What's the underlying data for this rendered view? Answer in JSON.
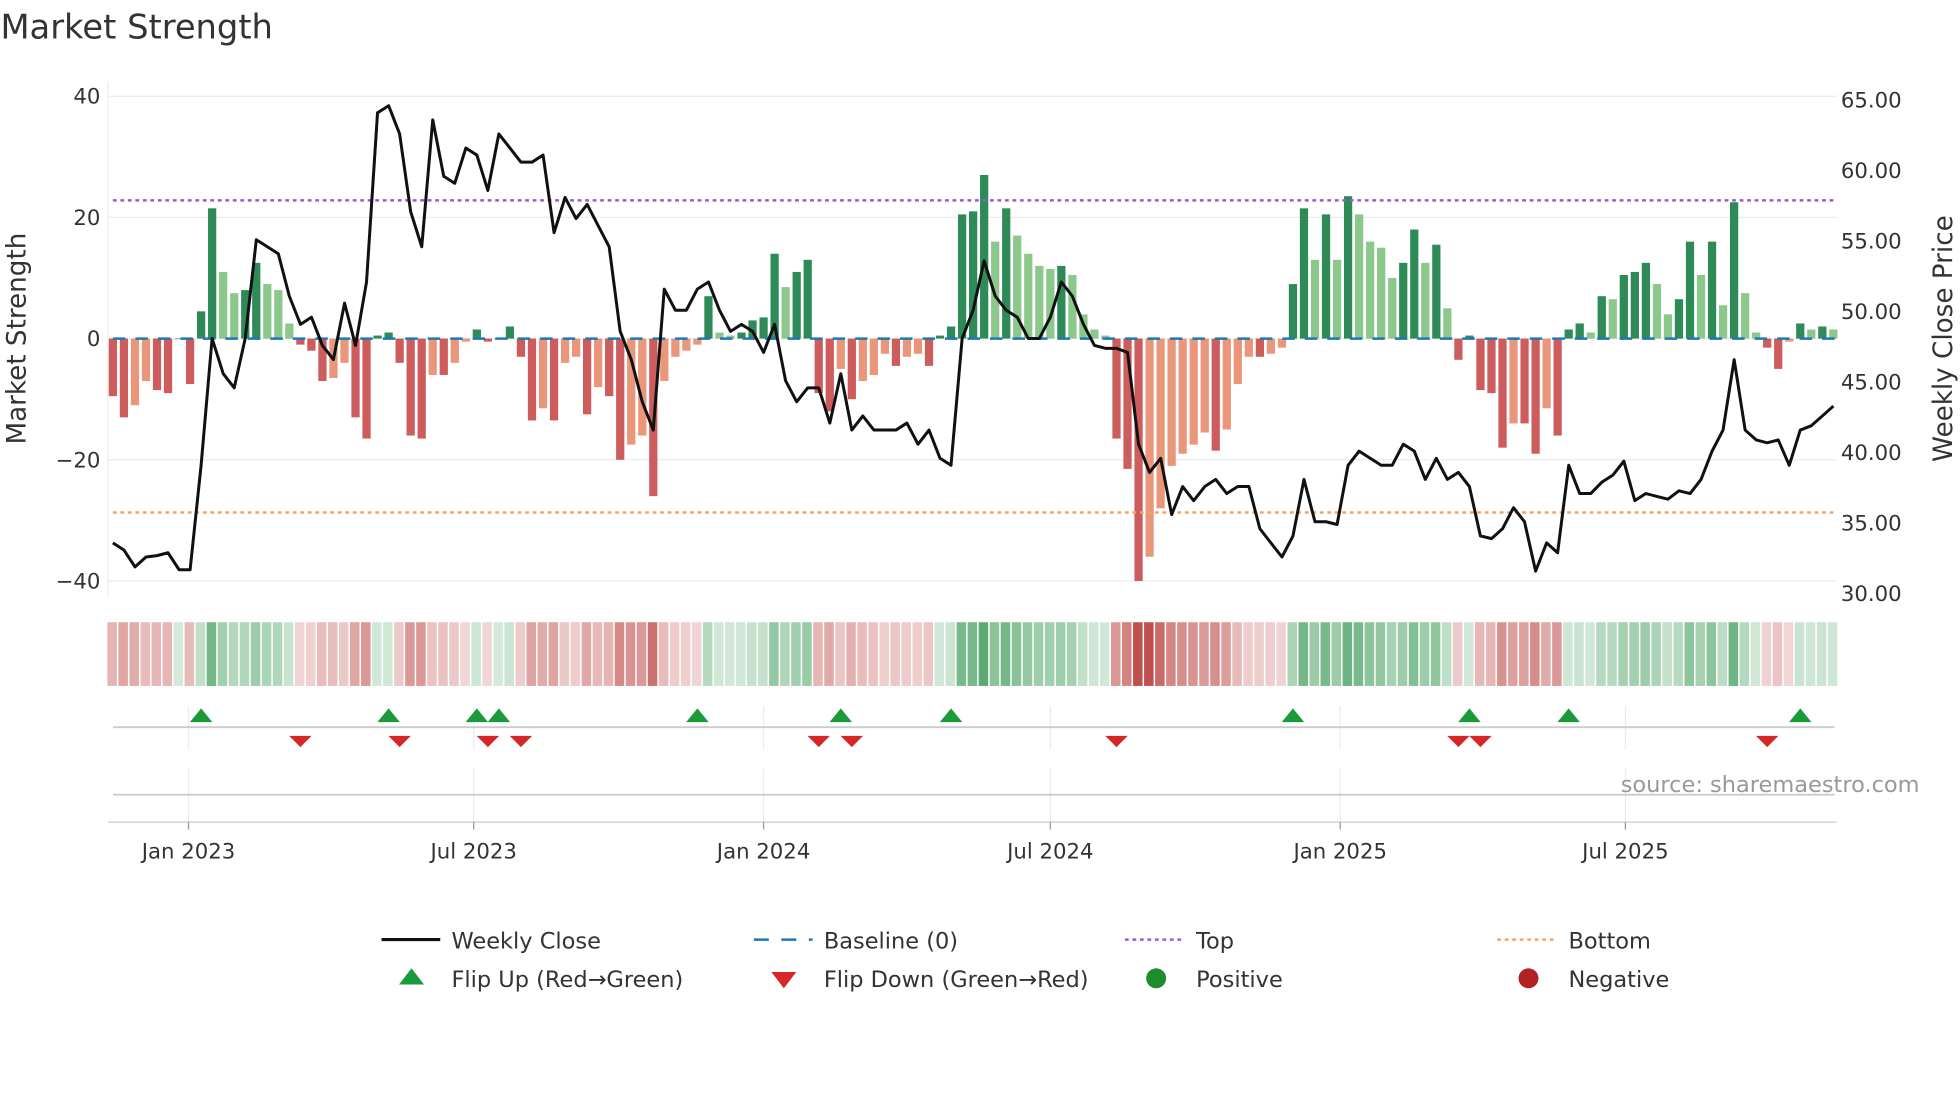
{
  "title": "Market Strength",
  "source": "source: sharemaestro.com",
  "chart_data": {
    "type": "bar",
    "title": "Market Strength",
    "ylabel": "Market Strength",
    "y2label": "Weekly Close Price",
    "ylim": [
      -42,
      42
    ],
    "y2lim": [
      29.5,
      66.5
    ],
    "yticks": [
      "40",
      "20",
      "0",
      "−20",
      "−40"
    ],
    "ytick_values": [
      40,
      20,
      0,
      -20,
      -40
    ],
    "y2ticks": [
      "65.00",
      "60.00",
      "55.00",
      "50.00",
      "45.00",
      "40.00",
      "35.00",
      "30.00"
    ],
    "y2tick_values": [
      65,
      60,
      55,
      50,
      45,
      40,
      35,
      30
    ],
    "xticks": [
      "Jan 2023",
      "Jul 2023",
      "Jan 2024",
      "Jul 2024",
      "Jan 2025",
      "Jul 2025"
    ],
    "xtick_dates": [
      "2023-01-01",
      "2023-07-01",
      "2024-01-01",
      "2024-07-01",
      "2025-01-01",
      "2025-07-01"
    ],
    "x_start": "2022-11-14",
    "x_step_days": 7,
    "top": 22.8,
    "bottom": -28.7,
    "baseline": 0,
    "strength": [
      -9.5,
      -13,
      -11,
      -7,
      -8.5,
      -9,
      0,
      -7.5,
      4.5,
      21.5,
      11,
      7.5,
      8,
      12.5,
      9,
      8,
      2.5,
      -1,
      -2,
      -7,
      -6.5,
      -4,
      -13,
      -16.5,
      0.5,
      1,
      -4,
      -16,
      -16.5,
      -6,
      -6,
      -4,
      -0.5,
      1.5,
      -0.5,
      0,
      2,
      -3,
      -13.5,
      -11.5,
      -13.5,
      -4,
      -3,
      -12.5,
      -8,
      -9.5,
      -20,
      -17.5,
      -16,
      -26,
      -7,
      -3,
      -2,
      -1,
      7,
      1,
      0.5,
      1,
      3,
      3.5,
      14,
      8.5,
      11,
      13,
      -9,
      -12,
      -5,
      -10,
      -7,
      -6,
      -2.5,
      -4.5,
      -3,
      -2.5,
      -4.5,
      0.5,
      2,
      20.5,
      21,
      27,
      16,
      21.5,
      17,
      14,
      12,
      11.5,
      12,
      10.5,
      4,
      1.5,
      0.5,
      -16.5,
      -21.5,
      -40,
      -36,
      -28,
      -21,
      -19,
      -17.5,
      -15.5,
      -18.5,
      -15,
      -7.5,
      -3,
      -3,
      -2.5,
      -1.5,
      9,
      21.5,
      13,
      20.5,
      13,
      23.5,
      20.5,
      16,
      15,
      10,
      12.5,
      18,
      12.5,
      15.5,
      5,
      -3.5,
      0.5,
      -8.5,
      -9,
      -18,
      -14,
      -14,
      -19,
      -11.5,
      -16,
      1.5,
      2.5,
      1,
      7,
      6.5,
      10.5,
      11,
      12.5,
      9,
      4,
      6.5,
      16,
      10.5,
      16,
      5.5,
      22.5,
      7.5,
      1,
      -1.5,
      -5,
      -0.5,
      2.5,
      1.5,
      2,
      1.5
    ],
    "close": [
      33.5,
      33,
      31.8,
      32.5,
      32.6,
      32.8,
      31.6,
      31.6,
      39,
      48,
      45.5,
      44.5,
      48,
      55,
      54.5,
      54,
      51,
      49,
      49.5,
      47.5,
      46.5,
      50.5,
      47.5,
      52,
      64,
      64.5,
      62.5,
      57,
      54.5,
      63.5,
      59.5,
      59,
      61.5,
      61,
      58.5,
      62.5,
      61.5,
      60.5,
      60.5,
      61,
      55.5,
      58,
      56.5,
      57.5,
      56,
      54.5,
      48.5,
      46.5,
      43.5,
      41.5,
      51.5,
      50,
      50,
      51.5,
      52,
      50,
      48.5,
      49,
      48.5,
      47,
      49,
      45,
      43.5,
      44.5,
      44.5,
      42,
      45.5,
      41.5,
      42.5,
      41.5,
      41.5,
      41.5,
      42,
      40.5,
      41.5,
      39.5,
      39,
      48,
      50,
      53.5,
      51,
      50,
      49.5,
      48,
      48,
      49.5,
      52,
      51,
      49,
      47.5,
      47.3,
      47.3,
      47,
      40.5,
      38.5,
      39.5,
      35.5,
      37.5,
      36.5,
      37.5,
      38,
      37,
      37.5,
      37.5,
      34.5,
      33.5,
      32.5,
      34,
      38,
      35,
      35,
      34.8,
      39,
      40,
      39.5,
      39,
      39,
      40.5,
      40,
      38,
      39.5,
      38,
      38.5,
      37.5,
      34,
      33.8,
      34.5,
      36,
      35,
      31.5,
      33.5,
      32.8,
      39,
      37,
      37,
      37.8,
      38.3,
      39.3,
      36.5,
      37,
      36.8,
      36.6,
      37.2,
      37,
      38,
      40,
      41.5,
      46.5,
      41.5,
      40.8,
      40.6,
      40.8,
      39,
      41.5,
      41.8,
      42.5,
      43.2
    ],
    "flip_up_indices": [
      8,
      25,
      33,
      35,
      53,
      66,
      76,
      107,
      123,
      132,
      153
    ],
    "flip_down_indices": [
      17,
      26,
      34,
      37,
      64,
      67,
      91,
      122,
      124,
      150
    ],
    "legend": {
      "placement": "bottom",
      "items": [
        {
          "label": "Weekly Close",
          "kind": "line"
        },
        {
          "label": "Baseline (0)",
          "kind": "dash"
        },
        {
          "label": "Top",
          "kind": "dot-purple"
        },
        {
          "label": "Bottom",
          "kind": "dot-orange"
        },
        {
          "label": "Flip Up (Red→Green)",
          "kind": "tri-up"
        },
        {
          "label": "Flip Down (Green→Red)",
          "kind": "tri-down"
        },
        {
          "label": "Positive",
          "kind": "circle-green"
        },
        {
          "label": "Negative",
          "kind": "circle-red"
        }
      ]
    },
    "colors": {
      "pos_dark": "#2e8b57",
      "pos_light": "#8cc88c",
      "neg_dark": "#cd5c5c",
      "neg_light": "#e9967a",
      "close": "#111111",
      "baseline": "#1f77b4",
      "top": "#9b59d6",
      "bottom": "#f4a460",
      "flip_up": "#1a9a3a",
      "flip_down": "#d62728",
      "positive": "#1e8c2e",
      "negative": "#b22222"
    }
  }
}
